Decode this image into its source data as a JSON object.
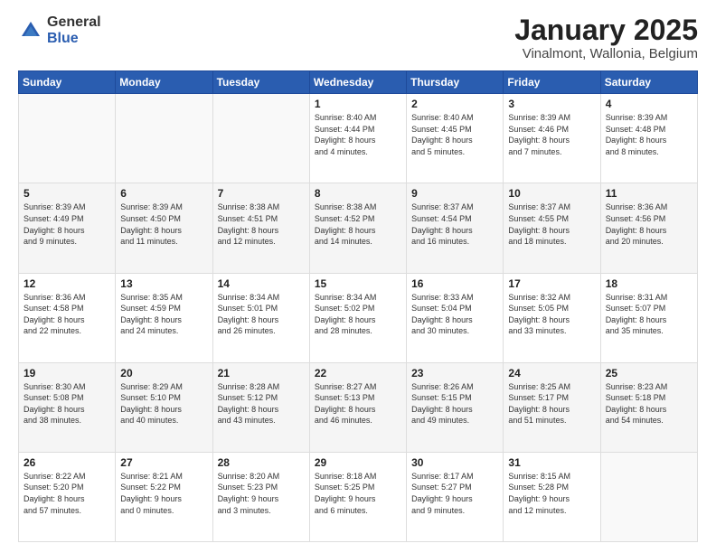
{
  "logo": {
    "general": "General",
    "blue": "Blue"
  },
  "header": {
    "title": "January 2025",
    "location": "Vinalmont, Wallonia, Belgium"
  },
  "weekdays": [
    "Sunday",
    "Monday",
    "Tuesday",
    "Wednesday",
    "Thursday",
    "Friday",
    "Saturday"
  ],
  "weeks": [
    [
      {
        "day": "",
        "info": ""
      },
      {
        "day": "",
        "info": ""
      },
      {
        "day": "",
        "info": ""
      },
      {
        "day": "1",
        "info": "Sunrise: 8:40 AM\nSunset: 4:44 PM\nDaylight: 8 hours\nand 4 minutes."
      },
      {
        "day": "2",
        "info": "Sunrise: 8:40 AM\nSunset: 4:45 PM\nDaylight: 8 hours\nand 5 minutes."
      },
      {
        "day": "3",
        "info": "Sunrise: 8:39 AM\nSunset: 4:46 PM\nDaylight: 8 hours\nand 7 minutes."
      },
      {
        "day": "4",
        "info": "Sunrise: 8:39 AM\nSunset: 4:48 PM\nDaylight: 8 hours\nand 8 minutes."
      }
    ],
    [
      {
        "day": "5",
        "info": "Sunrise: 8:39 AM\nSunset: 4:49 PM\nDaylight: 8 hours\nand 9 minutes."
      },
      {
        "day": "6",
        "info": "Sunrise: 8:39 AM\nSunset: 4:50 PM\nDaylight: 8 hours\nand 11 minutes."
      },
      {
        "day": "7",
        "info": "Sunrise: 8:38 AM\nSunset: 4:51 PM\nDaylight: 8 hours\nand 12 minutes."
      },
      {
        "day": "8",
        "info": "Sunrise: 8:38 AM\nSunset: 4:52 PM\nDaylight: 8 hours\nand 14 minutes."
      },
      {
        "day": "9",
        "info": "Sunrise: 8:37 AM\nSunset: 4:54 PM\nDaylight: 8 hours\nand 16 minutes."
      },
      {
        "day": "10",
        "info": "Sunrise: 8:37 AM\nSunset: 4:55 PM\nDaylight: 8 hours\nand 18 minutes."
      },
      {
        "day": "11",
        "info": "Sunrise: 8:36 AM\nSunset: 4:56 PM\nDaylight: 8 hours\nand 20 minutes."
      }
    ],
    [
      {
        "day": "12",
        "info": "Sunrise: 8:36 AM\nSunset: 4:58 PM\nDaylight: 8 hours\nand 22 minutes."
      },
      {
        "day": "13",
        "info": "Sunrise: 8:35 AM\nSunset: 4:59 PM\nDaylight: 8 hours\nand 24 minutes."
      },
      {
        "day": "14",
        "info": "Sunrise: 8:34 AM\nSunset: 5:01 PM\nDaylight: 8 hours\nand 26 minutes."
      },
      {
        "day": "15",
        "info": "Sunrise: 8:34 AM\nSunset: 5:02 PM\nDaylight: 8 hours\nand 28 minutes."
      },
      {
        "day": "16",
        "info": "Sunrise: 8:33 AM\nSunset: 5:04 PM\nDaylight: 8 hours\nand 30 minutes."
      },
      {
        "day": "17",
        "info": "Sunrise: 8:32 AM\nSunset: 5:05 PM\nDaylight: 8 hours\nand 33 minutes."
      },
      {
        "day": "18",
        "info": "Sunrise: 8:31 AM\nSunset: 5:07 PM\nDaylight: 8 hours\nand 35 minutes."
      }
    ],
    [
      {
        "day": "19",
        "info": "Sunrise: 8:30 AM\nSunset: 5:08 PM\nDaylight: 8 hours\nand 38 minutes."
      },
      {
        "day": "20",
        "info": "Sunrise: 8:29 AM\nSunset: 5:10 PM\nDaylight: 8 hours\nand 40 minutes."
      },
      {
        "day": "21",
        "info": "Sunrise: 8:28 AM\nSunset: 5:12 PM\nDaylight: 8 hours\nand 43 minutes."
      },
      {
        "day": "22",
        "info": "Sunrise: 8:27 AM\nSunset: 5:13 PM\nDaylight: 8 hours\nand 46 minutes."
      },
      {
        "day": "23",
        "info": "Sunrise: 8:26 AM\nSunset: 5:15 PM\nDaylight: 8 hours\nand 49 minutes."
      },
      {
        "day": "24",
        "info": "Sunrise: 8:25 AM\nSunset: 5:17 PM\nDaylight: 8 hours\nand 51 minutes."
      },
      {
        "day": "25",
        "info": "Sunrise: 8:23 AM\nSunset: 5:18 PM\nDaylight: 8 hours\nand 54 minutes."
      }
    ],
    [
      {
        "day": "26",
        "info": "Sunrise: 8:22 AM\nSunset: 5:20 PM\nDaylight: 8 hours\nand 57 minutes."
      },
      {
        "day": "27",
        "info": "Sunrise: 8:21 AM\nSunset: 5:22 PM\nDaylight: 9 hours\nand 0 minutes."
      },
      {
        "day": "28",
        "info": "Sunrise: 8:20 AM\nSunset: 5:23 PM\nDaylight: 9 hours\nand 3 minutes."
      },
      {
        "day": "29",
        "info": "Sunrise: 8:18 AM\nSunset: 5:25 PM\nDaylight: 9 hours\nand 6 minutes."
      },
      {
        "day": "30",
        "info": "Sunrise: 8:17 AM\nSunset: 5:27 PM\nDaylight: 9 hours\nand 9 minutes."
      },
      {
        "day": "31",
        "info": "Sunrise: 8:15 AM\nSunset: 5:28 PM\nDaylight: 9 hours\nand 12 minutes."
      },
      {
        "day": "",
        "info": ""
      }
    ]
  ]
}
